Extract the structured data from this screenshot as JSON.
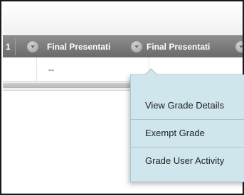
{
  "grid": {
    "columns": [
      {
        "label": "1"
      },
      {
        "label": "Final Presentati"
      },
      {
        "label": "Final Presentati"
      }
    ],
    "row": {
      "value": "--"
    }
  },
  "context_menu": {
    "items": [
      {
        "label": "View Grade Details"
      },
      {
        "label": "Exempt Grade"
      },
      {
        "label": "Grade User Activity"
      }
    ]
  }
}
